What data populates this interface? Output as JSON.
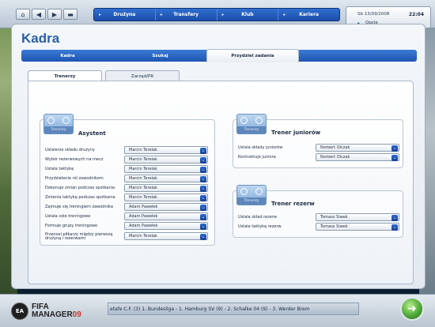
{
  "topbar": {
    "nav_icons": [
      "home-icon",
      "back-icon",
      "forward-icon",
      "menu-icon"
    ],
    "menu": [
      {
        "label": "Drużyna"
      },
      {
        "label": "Transfery"
      },
      {
        "label": "Klub"
      },
      {
        "label": "Kariera"
      }
    ],
    "date": "Sb 13/09/2008",
    "time": "22:04",
    "options_label": "Opcje"
  },
  "page_title": "Kadra",
  "main_tabs": [
    {
      "label": "Kadra"
    },
    {
      "label": "Szukaj"
    },
    {
      "label": "Przydziel zadania",
      "active": true
    }
  ],
  "sub_tabs": [
    {
      "label": "Trenerzy",
      "active": true
    },
    {
      "label": "Zarząd/PR"
    }
  ],
  "assistant": {
    "badge": "Trenerzy",
    "title": "Asystent",
    "rows": [
      {
        "label": "Ustalenie składu drużyny",
        "value": "Marcin Terelak"
      },
      {
        "label": "Wybór rezerwowych na mecz",
        "value": "Marcin Terelak"
      },
      {
        "label": "Ustala taktykę",
        "value": "Marcin Terelak"
      },
      {
        "label": "Przydzielenie ról zawodnikom",
        "value": "Marcin Terelak"
      },
      {
        "label": "Dokonuje zmian podczas spotkania",
        "value": "Marcin Terelak"
      },
      {
        "label": "Zmienia taktykę podczas spotkania",
        "value": "Marcin Terelak"
      },
      {
        "label": "Zajmuje się treningiem zawodnika",
        "value": "Adam Pawełek"
      },
      {
        "label": "Ustala cele treningowe",
        "value": "Adam Pawełek"
      },
      {
        "label": "Formuje grupy treningowe",
        "value": "Adam Pawełek"
      },
      {
        "label": "Przenosi piłkarzy między pierwszą drużyną i rezerwami",
        "value": "Marcin Terelak"
      }
    ]
  },
  "junior_coach": {
    "badge": "Trenerzy",
    "title": "Trener juniorów",
    "rows": [
      {
        "label": "Ustala składy juniorów",
        "value": "Norbert Olczak"
      },
      {
        "label": "Kontraktuje juniora",
        "value": "Norbert Olczak"
      }
    ]
  },
  "reserve_coach": {
    "badge": "Trenerzy",
    "title": "Trener rezerw",
    "rows": [
      {
        "label": "Ustala skład rezerw",
        "value": "Tomasz Siwek"
      },
      {
        "label": "Ustala taktykę rezerw",
        "value": "Tomasz Siwek"
      }
    ]
  },
  "bottom": {
    "logo_ea": "EA",
    "logo_ea_sub": "SPORTS",
    "logo_line1": "FIFA",
    "logo_line2": "MANAGER",
    "logo_year": "09",
    "ticker": "etafe C.F. (3)      1. Bundesliga - 1. Hamburg SV (9) - 2. Schalke 04 (9) - 3. Werder Brem"
  }
}
